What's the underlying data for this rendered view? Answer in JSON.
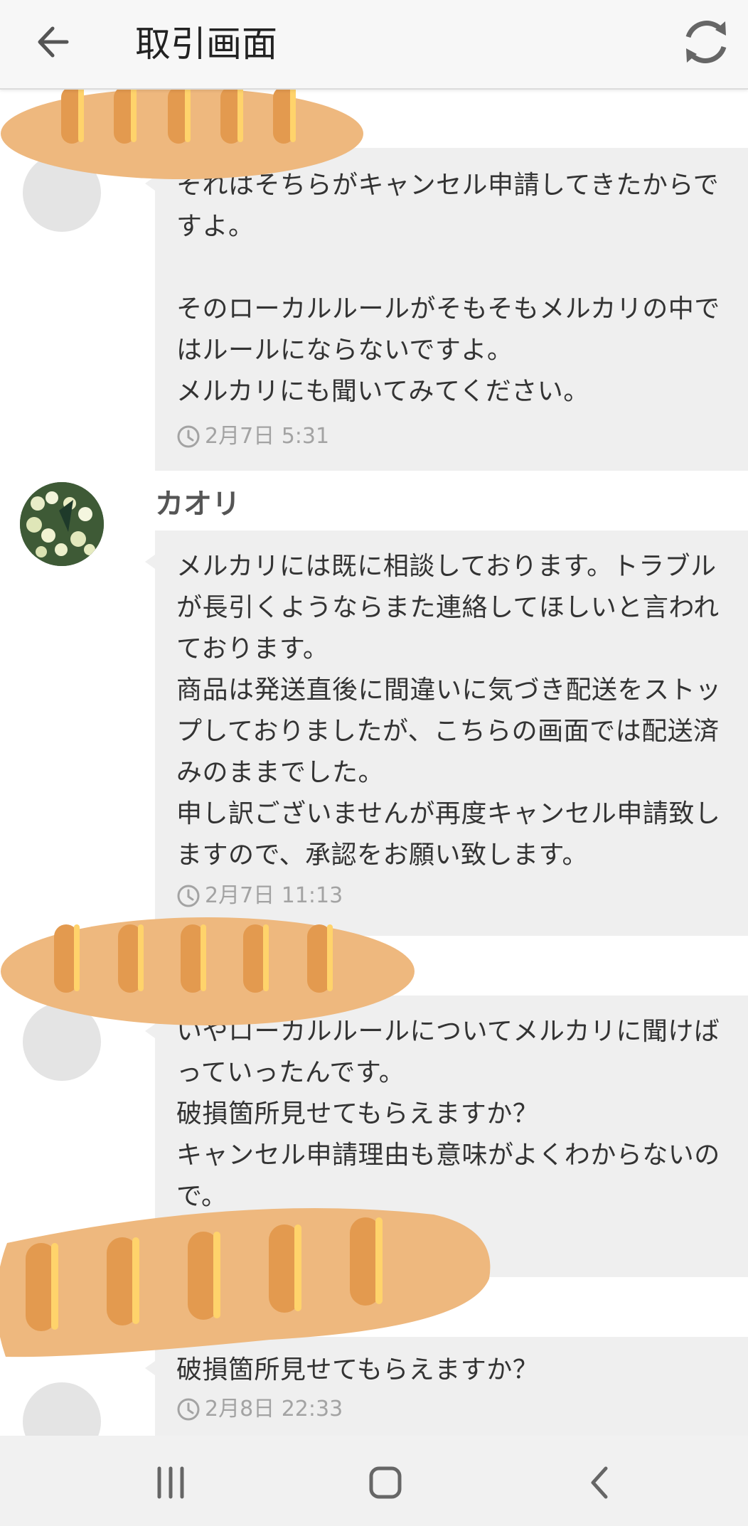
{
  "header": {
    "title": "取引画面",
    "back_icon": "arrow-left-icon",
    "refresh_icon": "refresh-icon"
  },
  "messages": [
    {
      "sender": "",
      "text": "それはそちらがキャンセル申請してきたからですよ。\n\nそのローカルルールがそもそもメルカリの中ではルールにならないですよ。\nメルカリにも聞いてみてください。",
      "time": "2月7日 5:31"
    },
    {
      "sender": "カオリ",
      "text": "メルカリには既に相談しております。トラブルが長引くようならまた連絡してほしいと言われております。\n商品は発送直後に間違いに気づき配送をストップしておりましたが、こちらの画面では配送済みのままでした。\n申し訳ございませんが再度キャンセル申請致しますので、承認をお願い致します。",
      "time": "2月7日 11:13"
    },
    {
      "sender": "",
      "text": "いやローカルルールについてメルカリに聞けばっていったんです。\n破損箇所見せてもらえますか？\nキャンセル申請理由も意味がよくわからないので。",
      "time": ""
    },
    {
      "sender": "",
      "text": "破損箇所見せてもらえますか？",
      "time": "2月8日 22:33"
    }
  ],
  "navbar": {
    "recents_icon": "recents-icon",
    "home_icon": "home-icon",
    "back_icon": "nav-back-icon"
  },
  "colors": {
    "bubble": "#efefef",
    "header_bg": "#f7f7f7",
    "time_text": "#a3a3a3",
    "redaction_bread": "#eeb87e",
    "redaction_stripe": "#e39a4f",
    "redaction_highlight": "#ffd36b"
  }
}
